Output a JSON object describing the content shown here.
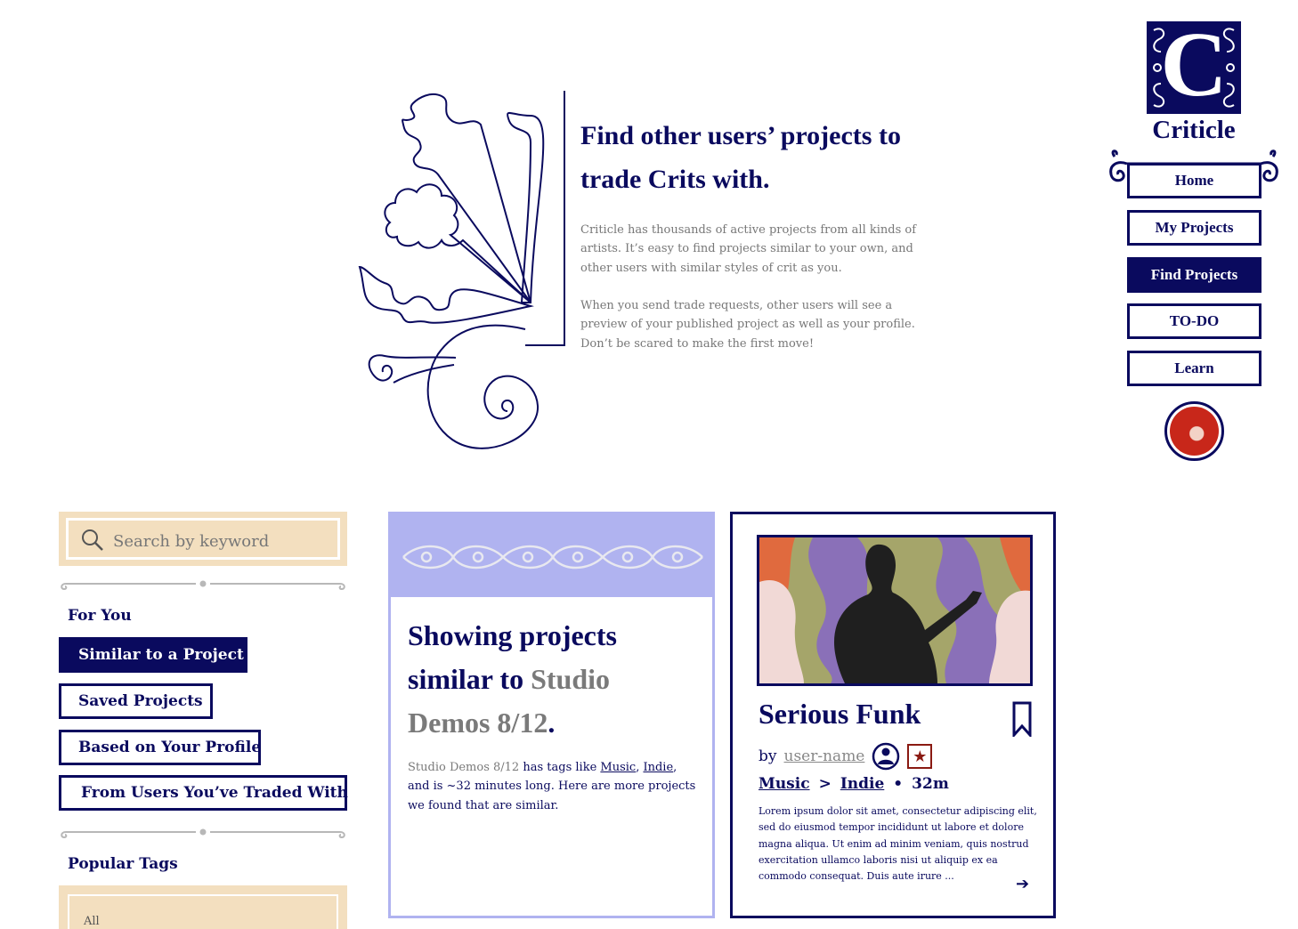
{
  "brand": {
    "logo_letter": "C",
    "name": "Criticle"
  },
  "nav": {
    "items": [
      {
        "label": "Home",
        "active": false
      },
      {
        "label": "My Projects",
        "active": false
      },
      {
        "label": "Find Projects",
        "active": true
      },
      {
        "label": "TO-DO",
        "active": false
      },
      {
        "label": "Learn",
        "active": false
      }
    ]
  },
  "hero": {
    "title": "Find other users’ projects to trade Crits with.",
    "paragraph_1": "Criticle has thousands of active projects from all kinds of artists. It’s easy to find projects similar to your own, and other users with similar styles of crit as you.",
    "paragraph_2": "When you send trade requests, other users will see a preview of your published project as well as your profile. Don’t be scared to make the first move!"
  },
  "sidebar": {
    "search_placeholder": "Search by keyword",
    "for_you_heading": "For You",
    "filters": [
      {
        "label": "Similar to a Project",
        "active": true
      },
      {
        "label": "Saved Projects",
        "active": false
      },
      {
        "label": "Based on Your Profile",
        "active": false
      },
      {
        "label": "From Users You’ve Traded With",
        "active": false
      }
    ],
    "popular_tags_heading": "Popular Tags",
    "tags": [
      "All"
    ]
  },
  "similar_card": {
    "title_prefix": "Showing projects similar to ",
    "project_name": "Studio Demos 8/12",
    "title_suffix": ".",
    "desc_project": "Studio Demos 8/12",
    "desc_has_tags": " has tags like ",
    "tag_1": "Music",
    "desc_comma": ", ",
    "tag_2": "Indie",
    "desc_rest": ", and is ~32 minutes long. Here are more projects we found that are similar."
  },
  "project_card": {
    "title": "Serious Funk",
    "by": "by",
    "user": "user-name",
    "category": "Music",
    "subcategory": "Indie",
    "duration": "32m",
    "description": "Lorem ipsum dolor sit amet, consectetur adipiscing elit, sed do eiusmod tempor incididunt ut labore et dolore magna aliqua. Ut enim ad minim veniam, quis nostrud exercitation ullamco laboris nisi ut aliquip ex ea commodo consequat. Duis aute irure ...",
    "separator_arrow": ">",
    "dot": "•"
  },
  "colors": {
    "navy": "#0a0a5e",
    "tan": "#f3dfbf",
    "lavender": "#b0b3f0",
    "gray_text": "#777777"
  },
  "icons": [
    "search-icon",
    "bookmark-icon",
    "user-icon",
    "star-badge-icon",
    "arrow-right-icon",
    "ornament-flourish",
    "scroll-ornament-icon"
  ]
}
